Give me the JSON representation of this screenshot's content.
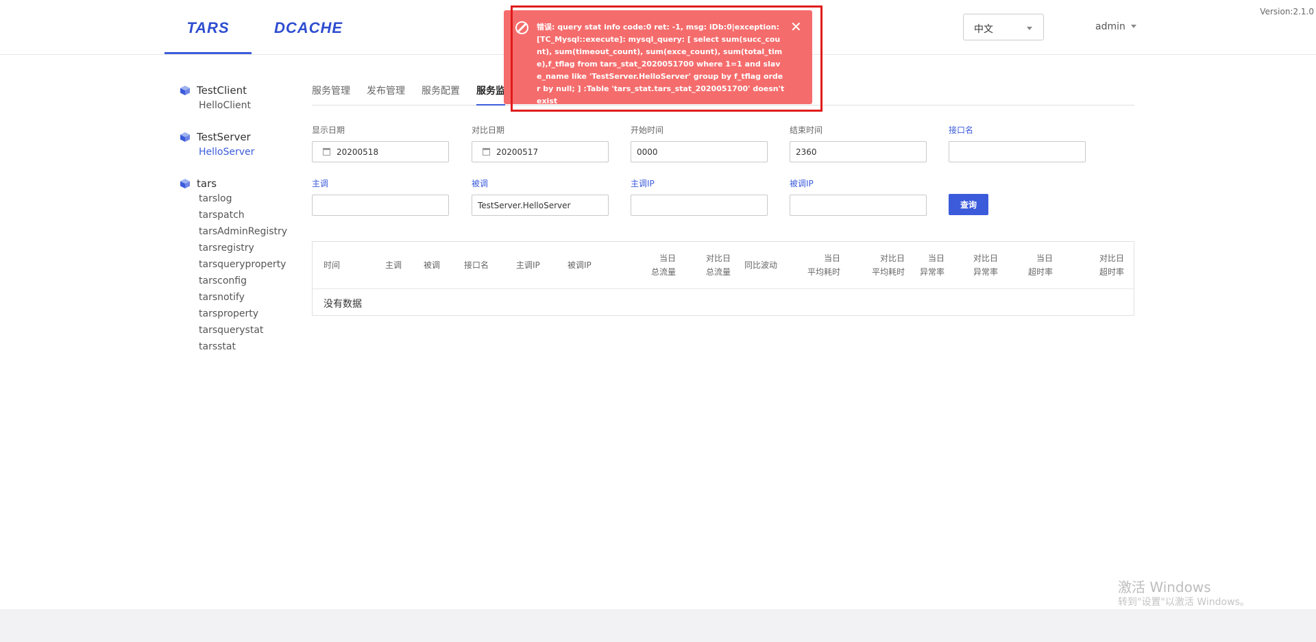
{
  "version": "Version:2.1.0",
  "header": {
    "logos": [
      "TARS",
      "DCACHE"
    ],
    "language": "中文",
    "user": "admin"
  },
  "sidebar": {
    "groups": [
      {
        "title": "TestClient",
        "items": [
          "HelloClient"
        ]
      },
      {
        "title": "TestServer",
        "items": [
          "HelloServer"
        ],
        "active_item": "HelloServer"
      },
      {
        "title": "tars",
        "items": [
          "tarslog",
          "tarspatch",
          "tarsAdminRegistry",
          "tarsregistry",
          "tarsqueryproperty",
          "tarsconfig",
          "tarsnotify",
          "tarsproperty",
          "tarsquerystat",
          "tarsstat"
        ]
      }
    ]
  },
  "tabs": [
    "服务管理",
    "发布管理",
    "服务配置",
    "服务监"
  ],
  "active_tab": "服务监",
  "filters": {
    "show_date": {
      "label": "显示日期",
      "value": "20200518"
    },
    "compare_date": {
      "label": "对比日期",
      "value": "20200517"
    },
    "start_time": {
      "label": "开始时间",
      "value": "0000"
    },
    "end_time": {
      "label": "结束时间",
      "value": "2360"
    },
    "interface": {
      "label": "接口名",
      "value": ""
    },
    "caller": {
      "label": "主调",
      "value": ""
    },
    "callee": {
      "label": "被调",
      "value": "TestServer.HelloServer"
    },
    "caller_ip": {
      "label": "主调IP",
      "value": ""
    },
    "callee_ip": {
      "label": "被调IP",
      "value": ""
    },
    "query_button": "查询"
  },
  "table": {
    "columns": [
      [
        "时间"
      ],
      [
        "主调"
      ],
      [
        "被调"
      ],
      [
        "接口名"
      ],
      [
        "主调IP"
      ],
      [
        "被调IP"
      ],
      [
        "当日",
        "总流量"
      ],
      [
        "对比日",
        "总流量"
      ],
      [
        "同比波动"
      ],
      [
        "当日",
        "平均耗时"
      ],
      [
        "对比日",
        "平均耗时"
      ],
      [
        "当日",
        "异常率"
      ],
      [
        "对比日",
        "异常率"
      ],
      [
        "当日",
        "超时率"
      ],
      [
        "对比日",
        "超时率"
      ]
    ],
    "empty_text": "没有数据"
  },
  "toast": {
    "message": "错误: query stat info code:0 ret: -1, msg: iDb:0|exception:[TC_Mysql::execute]: mysql_query: [ select sum(succ_count), sum(timeout_count), sum(exce_count), sum(total_time),f_tflag from tars_stat_2020051700 where 1=1 and slave_name like 'TestServer.HelloServer' group by f_tflag order by null; ] :Table 'tars_stat.tars_stat_2020051700' doesn't exist",
    "close_glyph": "✕"
  },
  "watermark": {
    "line1": "激活 Windows",
    "line2": "转到\"设置\"以激活 Windows。"
  }
}
